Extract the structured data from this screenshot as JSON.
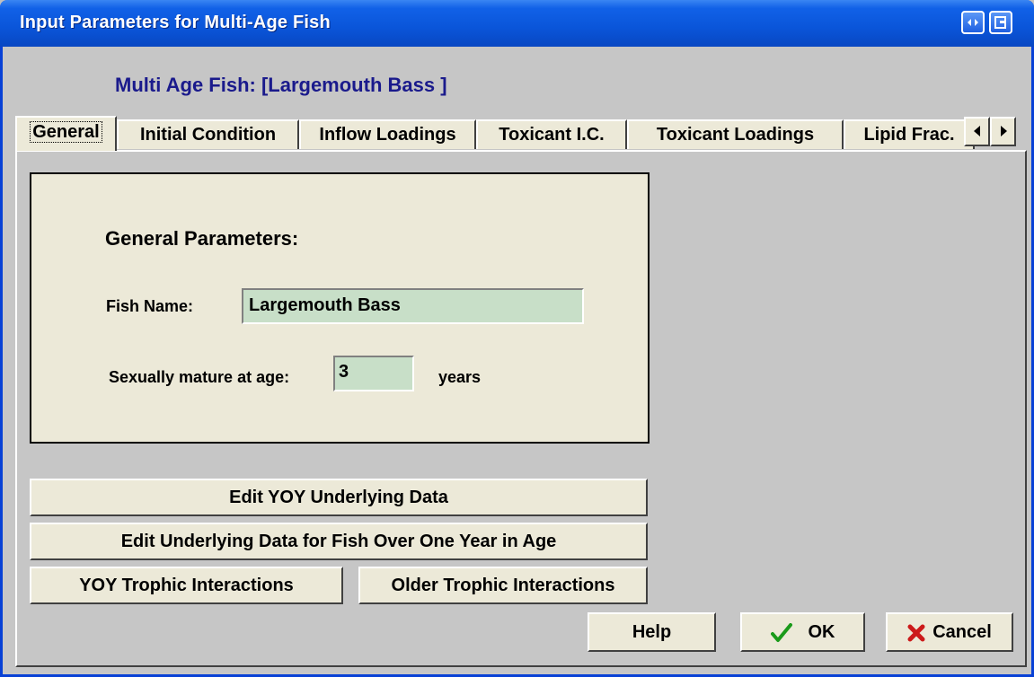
{
  "window": {
    "title": "Input Parameters for Multi-Age Fish"
  },
  "heading": "Multi Age Fish: [Largemouth Bass ]",
  "tabs": [
    {
      "label": "General",
      "active": true
    },
    {
      "label": "Initial Condition",
      "active": false
    },
    {
      "label": "Inflow Loadings",
      "active": false
    },
    {
      "label": "Toxicant I.C.",
      "active": false
    },
    {
      "label": "Toxicant Loadings",
      "active": false
    },
    {
      "label": "Lipid Frac.",
      "active": false
    }
  ],
  "general": {
    "group_title": "General Parameters:",
    "fish_name_label": "Fish Name:",
    "fish_name_value": "Largemouth Bass",
    "mature_label": "Sexually mature at age:",
    "mature_value": "3",
    "mature_unit": "years"
  },
  "buttons": {
    "edit_yoy": "Edit YOY Underlying Data",
    "edit_over_one": "Edit Underlying Data for Fish Over One Year in Age",
    "yoy_trophic": "YOY Trophic Interactions",
    "older_trophic": "Older Trophic Interactions",
    "help": "Help",
    "ok": "OK",
    "cancel": "Cancel"
  },
  "colors": {
    "title_bar": "#0a55d9",
    "heading_text": "#1a1a8c",
    "field_bg": "#c8dfc8",
    "panel_bg": "#ece9d8",
    "ok_check": "#1a9a1a",
    "cancel_x": "#cc1a1a"
  },
  "icons": {
    "title_btn1": "restore-icon",
    "title_btn2": "maximize-icon",
    "scroll_left": "arrow-left-icon",
    "scroll_right": "arrow-right-icon",
    "ok": "check-icon",
    "cancel": "x-icon"
  }
}
